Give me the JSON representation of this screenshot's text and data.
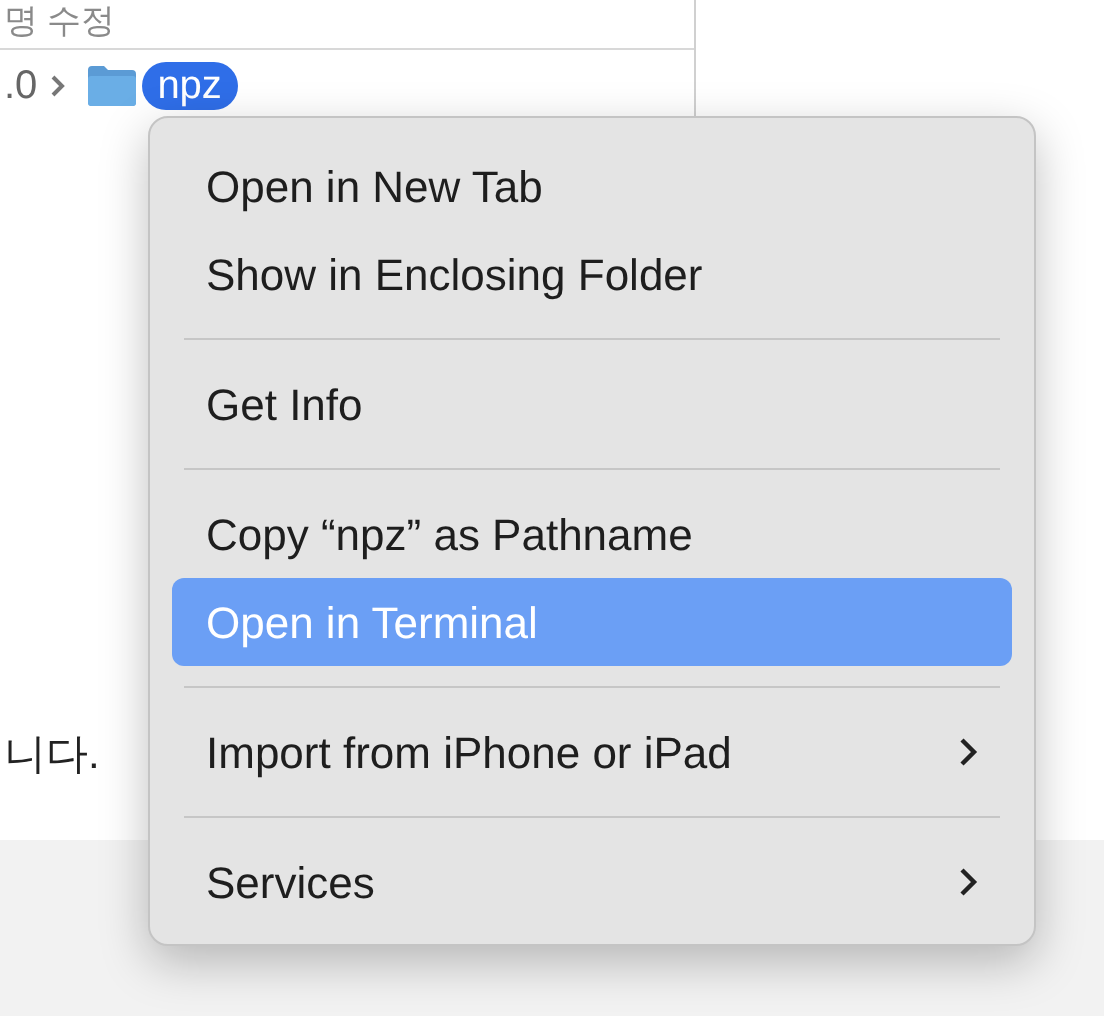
{
  "background": {
    "header_text": "명 수정",
    "breadcrumb": [
      {
        "kind": "plain",
        "label": ".0",
        "selected": false
      },
      {
        "kind": "folder",
        "label": "npz",
        "selected": true
      }
    ],
    "body_text": "니다."
  },
  "context_menu": {
    "groups": [
      [
        {
          "label": "Open in New Tab",
          "selected": false,
          "submenu": false
        },
        {
          "label": "Show in Enclosing Folder",
          "selected": false,
          "submenu": false
        }
      ],
      [
        {
          "label": "Get Info",
          "selected": false,
          "submenu": false
        }
      ],
      [
        {
          "label": "Copy “npz” as Pathname",
          "selected": false,
          "submenu": false
        },
        {
          "label": "Open in Terminal",
          "selected": true,
          "submenu": false
        }
      ],
      [
        {
          "label": "Import from iPhone or iPad",
          "selected": false,
          "submenu": true
        }
      ],
      [
        {
          "label": "Services",
          "selected": false,
          "submenu": true
        }
      ]
    ]
  }
}
